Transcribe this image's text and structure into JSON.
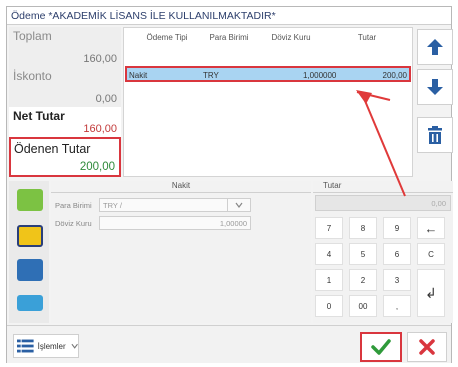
{
  "window": {
    "title": "Ödeme *AKADEMİK LİSANS İLE KULLANILMAKTADIR*"
  },
  "summary": {
    "toplam": {
      "label": "Toplam",
      "value": "160,00"
    },
    "iskonto": {
      "label": "İskonto",
      "value": "0,00"
    },
    "net": {
      "label": "Net Tutar",
      "value": "160,00"
    },
    "paid": {
      "label": "Ödenen Tutar",
      "value": "200,00"
    }
  },
  "grid": {
    "columns": [
      "Ödeme Tipi",
      "Para Birimi",
      "Döviz Kuru",
      "Tutar"
    ],
    "rows": [
      {
        "type": "Nakit",
        "currency": "TRY",
        "rate": "1,000000",
        "amount": "200,00"
      }
    ]
  },
  "nav": {
    "up_icon": "arrow-up-icon",
    "down_icon": "arrow-down-icon",
    "delete_icon": "trash-icon"
  },
  "payment_types": {
    "icons": [
      "cash-icon",
      "card-icon",
      "card-icon",
      "card-icon"
    ]
  },
  "nakit": {
    "title": "Nakit",
    "currency_label": "Para Birimi",
    "currency_value": "TRY /",
    "currency_code": "1,00000",
    "rate_label": "Döviz Kuru",
    "rate_value": "1,000000"
  },
  "tutar": {
    "title": "Tutar",
    "display": "0,00",
    "keys": [
      "7",
      "8",
      "9",
      "←",
      "4",
      "5",
      "6",
      "C",
      "1",
      "2",
      "3",
      "↲",
      "0",
      "00",
      ","
    ]
  },
  "bottom": {
    "menu_label": "İşlemler",
    "ok_icon": "checkmark-icon",
    "cancel_icon": "close-icon"
  },
  "colors": {
    "accent_red": "#d9363e",
    "selection_blue": "#a9d4f2",
    "ok_green": "#2f9a3a",
    "nav_blue": "#2a5fa3"
  }
}
